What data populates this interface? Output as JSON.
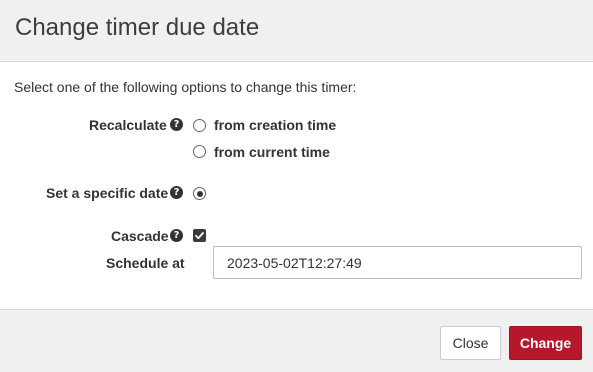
{
  "dialog": {
    "title": "Change timer due date",
    "intro": "Select one of the following options to change this timer:",
    "recalculate": {
      "label": "Recalculate",
      "options": [
        {
          "label": "from creation time",
          "selected": false
        },
        {
          "label": "from current time",
          "selected": false
        }
      ]
    },
    "specific_date": {
      "label": "Set a specific date",
      "selected": true
    },
    "cascade": {
      "label": "Cascade",
      "checked": true
    },
    "schedule_at": {
      "label": "Schedule at",
      "value": "2023-05-02T12:27:49"
    },
    "buttons": {
      "close": "Close",
      "change": "Change"
    },
    "icons": {
      "help": "question-circle-icon",
      "check": "checkmark-icon"
    },
    "colors": {
      "primary": "#b5182b",
      "header_bg": "#f0f0f0"
    }
  }
}
